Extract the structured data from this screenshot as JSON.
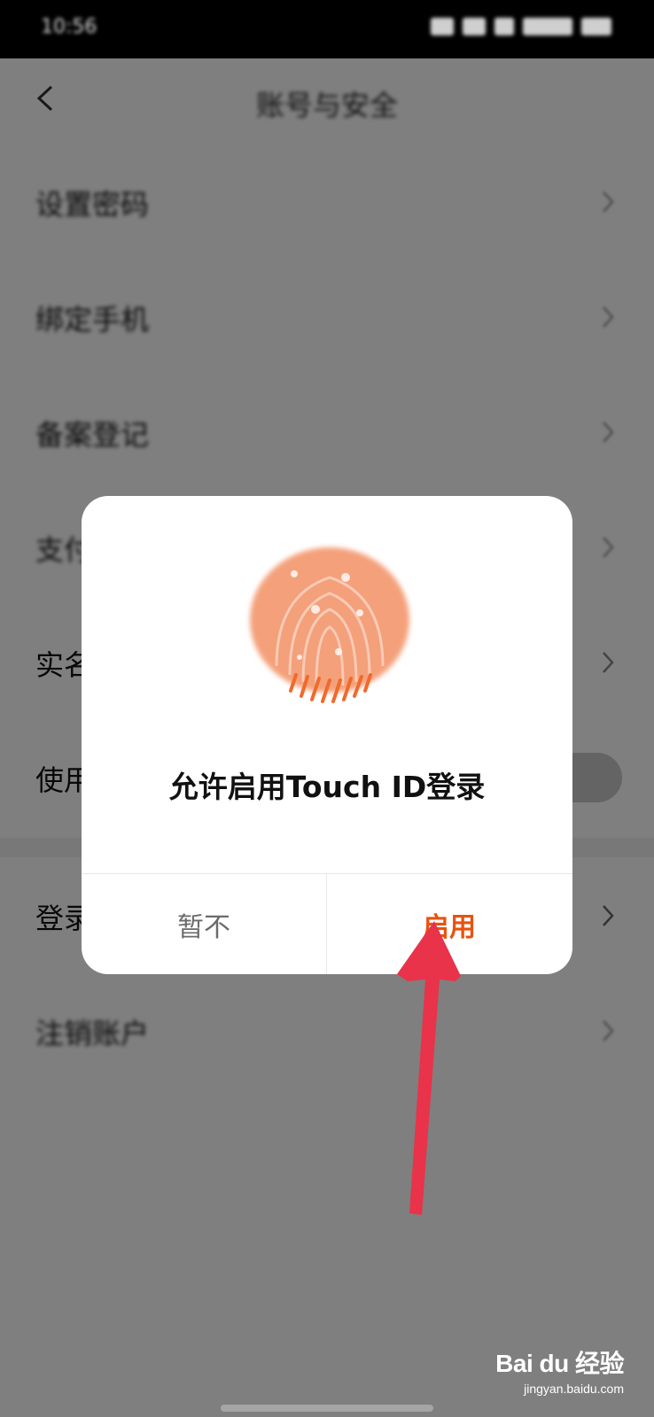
{
  "status_bar": {
    "time": "10:56"
  },
  "page": {
    "title": "账号与安全"
  },
  "settings_rows": [
    {
      "label": "设置密码"
    },
    {
      "label": "绑定手机"
    },
    {
      "label": "备案登记"
    },
    {
      "label": "支付"
    },
    {
      "label": "实名"
    },
    {
      "label": "使用"
    },
    {
      "label": "登录"
    },
    {
      "label": "注销账户"
    }
  ],
  "dialog": {
    "title": "允许启用Touch ID登录",
    "cancel_label": "暂不",
    "confirm_label": "启用",
    "accent_color": "#e8520f",
    "fingerprint_color": "#f4a07a"
  },
  "annotation": {
    "arrow_color": "#e8334a"
  },
  "watermark": {
    "brand": "Bai du 经验",
    "url": "jingyan.baidu.com"
  }
}
